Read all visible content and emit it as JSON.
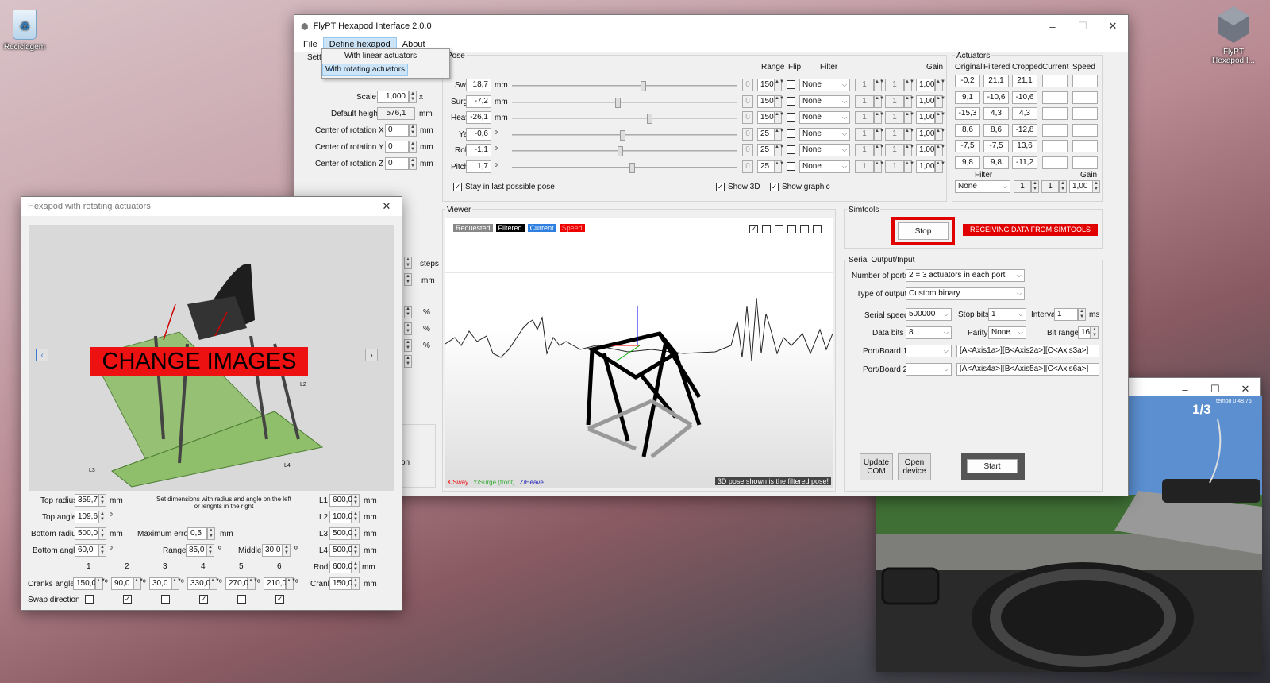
{
  "desktop": {
    "recycle_bin_label": "Reciclagem",
    "flypt_label_line1": "FlyPT",
    "flypt_label_line2": "Hexapod I..."
  },
  "main_window": {
    "title": "FlyPT Hexapod Interface 2.0.0",
    "menu": {
      "file": "File",
      "define": "Define hexapod",
      "about": "About"
    },
    "dropdown": {
      "linear": "With linear actuators",
      "rotating": "With rotating actuators"
    },
    "settings_label": "Setti",
    "settings": {
      "scale_label": "Scale",
      "scale_value": "1,000",
      "scale_unit": "x",
      "height_label": "Default height",
      "height_value": "576,1",
      "height_unit": "mm",
      "cx_label": "Center of rotation X",
      "cx_value": "0",
      "cy_label": "Center of rotation Y",
      "cy_value": "0",
      "cz_label": "Center of rotation Z",
      "cz_value": "0",
      "mm": "mm",
      "steps": "steps",
      "pct": "%",
      "on": "on"
    },
    "pose": {
      "title": "Pose",
      "col_range": "Range",
      "col_flip": "Flip",
      "col_filter": "Filter",
      "col_gain": "Gain",
      "rows": [
        {
          "label": "Sway",
          "value": "18,7",
          "unit": "mm",
          "pos": 0.58,
          "range": "150",
          "filter": "None",
          "a": "1",
          "b": "1",
          "gain": "1,00"
        },
        {
          "label": "Surge",
          "value": "-7,2",
          "unit": "mm",
          "pos": 0.47,
          "range": "150",
          "filter": "None",
          "a": "1",
          "b": "1",
          "gain": "1,00"
        },
        {
          "label": "Heave",
          "value": "-26,1",
          "unit": "mm",
          "pos": 0.61,
          "range": "150",
          "filter": "None",
          "a": "1",
          "b": "1",
          "gain": "1,00"
        },
        {
          "label": "Yaw",
          "value": "-0,6",
          "unit": "º",
          "pos": 0.49,
          "range": "25",
          "filter": "None",
          "a": "1",
          "b": "1",
          "gain": "1,00"
        },
        {
          "label": "Roll",
          "value": "-1,1",
          "unit": "º",
          "pos": 0.48,
          "range": "25",
          "filter": "None",
          "a": "1",
          "b": "1",
          "gain": "1,00"
        },
        {
          "label": "Pitch",
          "value": "1,7",
          "unit": "º",
          "pos": 0.53,
          "range": "25",
          "filter": "None",
          "a": "1",
          "b": "1",
          "gain": "1,00"
        }
      ],
      "zero": "0",
      "stay_label": "Stay in last possible pose",
      "show3d_label": "Show 3D",
      "showgraphic_label": "Show graphic"
    },
    "actuators": {
      "title": "Actuators",
      "headers": [
        "Original",
        "Filtered",
        "Cropped",
        "Current",
        "Speed"
      ],
      "rows": [
        [
          "-0,2",
          "21,1",
          "21,1"
        ],
        [
          "9,1",
          "-10,6",
          "-10,6"
        ],
        [
          "-15,3",
          "4,3",
          "4,3"
        ],
        [
          "8,6",
          "8,6",
          "-12,8"
        ],
        [
          "-7,5",
          "-7,5",
          "13,6"
        ],
        [
          "9,8",
          "9,8",
          "-11,2"
        ]
      ],
      "filter_label": "Filter",
      "gain_label": "Gain",
      "filter_value": "None",
      "a": "1",
      "b": "1",
      "gain_value": "1,00"
    },
    "viewer": {
      "title": "Viewer",
      "legend": [
        "Requested",
        "Filtered",
        "Current",
        "Speed"
      ],
      "axes": [
        "X/Sway",
        "Y/Surge (front)",
        "Z/Heave"
      ],
      "note": "3D pose shown is the filtered pose!"
    },
    "simtools": {
      "title": "Simtools",
      "stop": "Stop",
      "status": "RECEIVING DATA FROM SIMTOOLS"
    },
    "serial": {
      "title": "Serial Output/Input",
      "ports_label": "Number of ports",
      "ports_value": "2 = 3 actuators in each port",
      "type_label": "Type of output",
      "type_value": "Custom binary",
      "speed_label": "Serial speed",
      "speed_value": "500000",
      "stop_label": "Stop bits",
      "stop_value": "1",
      "interval_label": "Interval",
      "interval_value": "1",
      "interval_unit": "ms",
      "data_label": "Data bits",
      "data_value": "8",
      "parity_label": "Parity",
      "parity_value": "None",
      "bit_label": "Bit range",
      "bit_value": "16",
      "port1_label": "Port/Board 1",
      "port1_value": "[A<Axis1a>][B<Axis2a>][C<Axis3a>]",
      "port2_label": "Port/Board 2",
      "port2_value": "[A<Axis4a>][B<Axis5a>][C<Axis6a>]",
      "update_com": "Update COM",
      "open_device": "Open device",
      "start": "Start"
    }
  },
  "hexapod_window": {
    "title": "Hexapod with rotating actuators",
    "overlay": "CHANGE IMAGES",
    "hint": "Set dimensions with radius and angle on the left or lenghts in the right",
    "top_radius_label": "Top radius",
    "top_radius": "359,7",
    "mm": "mm",
    "top_angle_label": "Top angle",
    "top_angle": "109,6",
    "deg": "º",
    "bottom_radius_label": "Bottom radius",
    "bottom_radius": "500,0",
    "bottom_angle_label": "Bottom angle",
    "bottom_angle": "60,0",
    "max_error_label": "Maximum error",
    "max_error": "0,5",
    "range_label": "Range",
    "range": "85,0",
    "middle_label": "Middle",
    "middle": "30,0",
    "L1_label": "L1",
    "L1": "600,0",
    "L2_label": "L2",
    "L2": "100,0",
    "L3_label": "L3",
    "L3": "500,0",
    "L4_label": "L4",
    "L4": "500,0",
    "rod_label": "Rod",
    "rod": "600,0",
    "crank_label": "Crank",
    "crank": "150,0",
    "cranks_label": "Cranks angles",
    "crank_numbers": [
      "1",
      "2",
      "3",
      "4",
      "5",
      "6"
    ],
    "crank_angles": [
      "150,0",
      "90,0",
      "30,0",
      "330,0",
      "270,0",
      "210,0"
    ],
    "swap_label": "Swap direction",
    "swap": [
      false,
      true,
      false,
      true,
      false,
      true
    ],
    "img_labels": [
      "L2",
      "L3",
      "L4"
    ]
  },
  "game_window": {
    "counter": "1/3",
    "small": "tempo  0:48.76"
  }
}
